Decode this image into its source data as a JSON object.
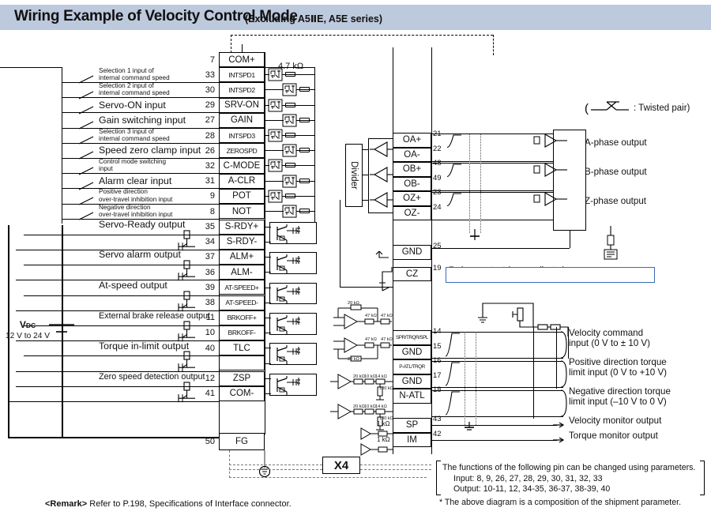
{
  "title": {
    "main": "Wiring Example of Velocity Control Mode",
    "sub": "(Excluding A5ⅡE, A5E series)"
  },
  "legend": {
    "twisted_pair": ": Twisted pair)"
  },
  "power": {
    "label": "V",
    "label_sub": "DC",
    "range": "12 V to 24 V"
  },
  "divider": {
    "label": "Divider"
  },
  "resistors": {
    "pullup": "4.7 kΩ",
    "sp": "1 kΩ",
    "im": "1 kΩ",
    "r20k_a": "20 kΩ",
    "r20k_b": "20 kΩ",
    "r47k": "47 kΩ",
    "r47k_b": "47 kΩ",
    "r47k_c": "47 kΩ",
    "r47k_d": "47 kΩ",
    "r47k_e": "47 kΩ",
    "r20k_t1": "20 kΩ",
    "r10k_t1": "10 kΩ",
    "r14k_t1": "14 kΩ",
    "r100k_t1": "100 kΩ",
    "r20k_t2": "20 kΩ",
    "r10k_t2": "10 kΩ",
    "r14k_t2": "14 kΩ",
    "r100k_t2": "100 kΩ"
  },
  "inputs": [
    {
      "pin": "7",
      "signal": "COM+",
      "desc": ""
    },
    {
      "pin": "33",
      "signal": "INTSPD1",
      "desc": "Selection 1 input of\ninternal command speed"
    },
    {
      "pin": "30",
      "signal": "INTSPD2",
      "desc": "Selection 2 input of\ninternal command speed"
    },
    {
      "pin": "29",
      "signal": "SRV-ON",
      "desc": "Servo-ON input"
    },
    {
      "pin": "27",
      "signal": "GAIN",
      "desc": "Gain switching input"
    },
    {
      "pin": "28",
      "signal": "INTSPD3",
      "desc": "Selection 3 input of\ninternal command speed"
    },
    {
      "pin": "26",
      "signal": "ZEROSPD",
      "desc": "Speed zero clamp input"
    },
    {
      "pin": "32",
      "signal": "C-MODE",
      "desc": "Control mode switching\ninput"
    },
    {
      "pin": "31",
      "signal": "A-CLR",
      "desc": "Alarm clear input"
    },
    {
      "pin": "9",
      "signal": "POT",
      "desc": "Positive direction\nover-travel inhibition input"
    },
    {
      "pin": "8",
      "signal": "NOT",
      "desc": "Negative direction\nover-travel inhibition input"
    }
  ],
  "outputs": [
    {
      "pin": "35",
      "signal": "S-RDY+",
      "desc": "Servo-Ready output"
    },
    {
      "pin": "34",
      "signal": "S-RDY-",
      "desc": ""
    },
    {
      "pin": "37",
      "signal": "ALM+",
      "desc": "Servo alarm output"
    },
    {
      "pin": "36",
      "signal": "ALM-",
      "desc": ""
    },
    {
      "pin": "39",
      "signal": "AT-SPEED+",
      "desc": "At-speed output"
    },
    {
      "pin": "38",
      "signal": "AT-SPEED-",
      "desc": ""
    },
    {
      "pin": "11",
      "signal": "BRKOFF+",
      "desc": "External brake release output"
    },
    {
      "pin": "10",
      "signal": "BRKOFF-",
      "desc": ""
    },
    {
      "pin": "40",
      "signal": "TLC",
      "desc": "Torque in-limit output"
    },
    {
      "pin": "",
      "signal": "",
      "desc": ""
    },
    {
      "pin": "12",
      "signal": "ZSP",
      "desc": "Zero speed detection output"
    },
    {
      "pin": "41",
      "signal": "COM-",
      "desc": ""
    }
  ],
  "fg": {
    "pin": "50",
    "signal": "FG"
  },
  "encoder": [
    {
      "pin": "21",
      "signal": "OA+",
      "out": "A-phase output"
    },
    {
      "pin": "22",
      "signal": "OA-",
      "out": ""
    },
    {
      "pin": "48",
      "signal": "OB+",
      "out": "B-phase output"
    },
    {
      "pin": "49",
      "signal": "OB-",
      "out": ""
    },
    {
      "pin": "23",
      "signal": "OZ+",
      "out": "Z-phase output"
    },
    {
      "pin": "24",
      "signal": "OZ-",
      "out": ""
    }
  ],
  "gnd_cz": [
    {
      "pin": "25",
      "signal": "GND",
      "note": ""
    },
    {
      "pin": "19",
      "signal": "CZ",
      "note": "Z-phase output (open collector)"
    }
  ],
  "analog": [
    {
      "pin": "14",
      "signal": "SPR/TRQR/SPL",
      "note": "Velocity command",
      "note2": "input (0 V to ± 10 V)"
    },
    {
      "pin": "15",
      "signal": "GND",
      "note": "",
      "note2": ""
    },
    {
      "pin": "16",
      "signal": "P-ATL/TRQR",
      "note": "Positive direction torque",
      "note2": "limit input (0 V to +10 V)"
    },
    {
      "pin": "17",
      "signal": "GND",
      "note": "",
      "note2": ""
    },
    {
      "pin": "18",
      "signal": "N-ATL",
      "note": "Negative direction torque",
      "note2": "limit input (–10 V to 0 V)"
    },
    {
      "pin": "",
      "signal": "",
      "note": "",
      "note2": ""
    },
    {
      "pin": "43",
      "signal": "SP",
      "note": "Velocity monitor output",
      "note2": ""
    },
    {
      "pin": "42",
      "signal": "IM",
      "note": "Torque monitor output",
      "note2": ""
    }
  ],
  "connector": {
    "label": "X4"
  },
  "notes": {
    "line1": "The functions of the following pin can be changed using parameters.",
    "line2": "Input: 8, 9, 26, 27, 28, 29, 30, 31, 32, 33",
    "line3": "Output: 10-11, 12, 34-35, 36-37, 38-39, 40",
    "line4": "* The above diagram is a composition of the shipment parameter."
  },
  "remark": {
    "tag": "<Remark>",
    "text": "Refer to P.198, Specifications of Interface connector."
  },
  "colors": {
    "title_bg": "#bdc9dd",
    "line": "#000000",
    "bg": "#ffffff"
  }
}
